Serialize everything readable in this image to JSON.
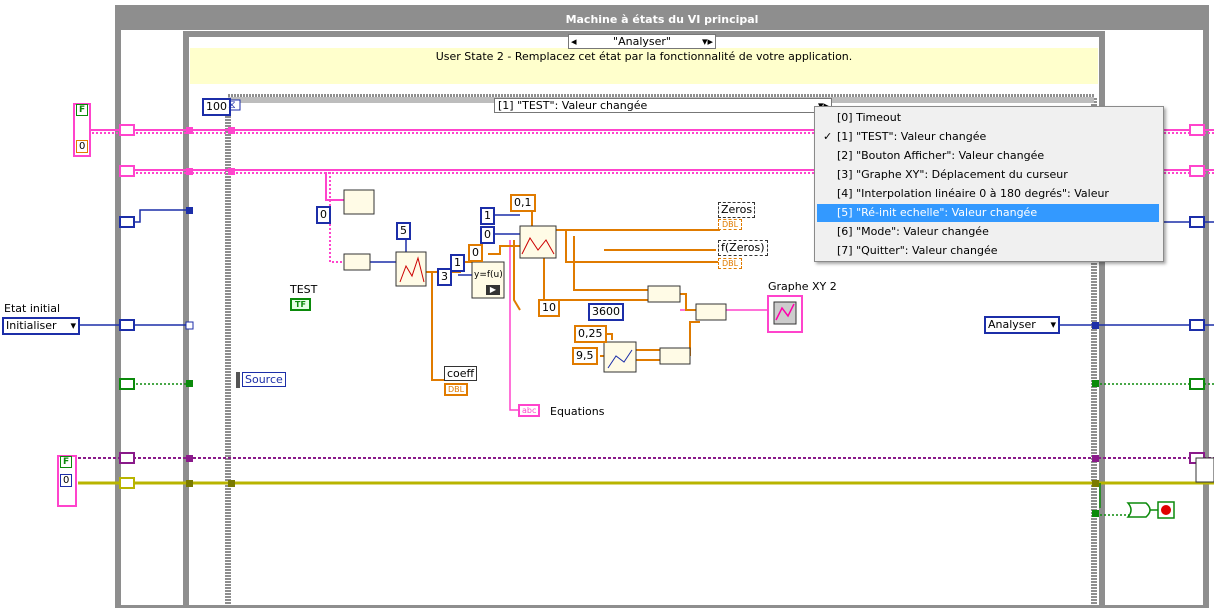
{
  "title": "Machine à états du VI principal",
  "case_selector": "\"Analyser\"",
  "comment": "User State 2 - Remplacez cet état par la fonctionnalité de votre application.",
  "timeout": "100",
  "event_selector": "[1] \"TEST\": Valeur changée",
  "event_menu": [
    {
      "label": "[0] Timeout",
      "checked": false,
      "selected": false
    },
    {
      "label": "[1] \"TEST\": Valeur changée",
      "checked": true,
      "selected": false
    },
    {
      "label": "[2] \"Bouton Afficher\": Valeur changée",
      "checked": false,
      "selected": false
    },
    {
      "label": "[3] \"Graphe XY\": Déplacement du curseur",
      "checked": false,
      "selected": false
    },
    {
      "label": "[4] \"Interpolation linéaire 0 à 180 degrés\": Valeur changée",
      "checked": false,
      "selected": false
    },
    {
      "label": "[5] \"Ré-init echelle\": Valeur changée",
      "checked": false,
      "selected": true
    },
    {
      "label": "[6] \"Mode\": Valeur changée",
      "checked": false,
      "selected": false
    },
    {
      "label": "[7] \"Quitter\": Valeur changée",
      "checked": false,
      "selected": false
    }
  ],
  "etat_initial_label": "Etat initial",
  "etat_initial_value": "Initialiser",
  "next_state_value": "Analyser",
  "test_label": "TEST",
  "test_terminal": "TF",
  "source_label": "Source",
  "graphe_label": "Graphe XY 2",
  "coeff_label": "coeff",
  "equations_label": "Equations",
  "zeros_label": "Zeros",
  "fzeros_label": "f(Zeros)",
  "dbl": "DBL",
  "abc": "abc",
  "f_left": "F",
  "f_bottom": "F",
  "zero_left": "0",
  "zero_bottom": "0",
  "constants": {
    "c0": "0",
    "c5": "5",
    "c1": "1",
    "c0b": "0",
    "c1b": "1",
    "c3": "3",
    "c0c": "0",
    "c01": "0,1",
    "c10": "10",
    "c3600": "3600",
    "c025": "0,25",
    "c95": "9,5"
  },
  "formula": "y=f(u)",
  "colors": {
    "pink": "#ff44cc",
    "blue": "#1c2ea8",
    "orange": "#e07b00",
    "green": "#0b8a0b",
    "yellow": "#b8b400",
    "purple": "#8a1a8a",
    "menu_highlight": "#3399ff"
  }
}
